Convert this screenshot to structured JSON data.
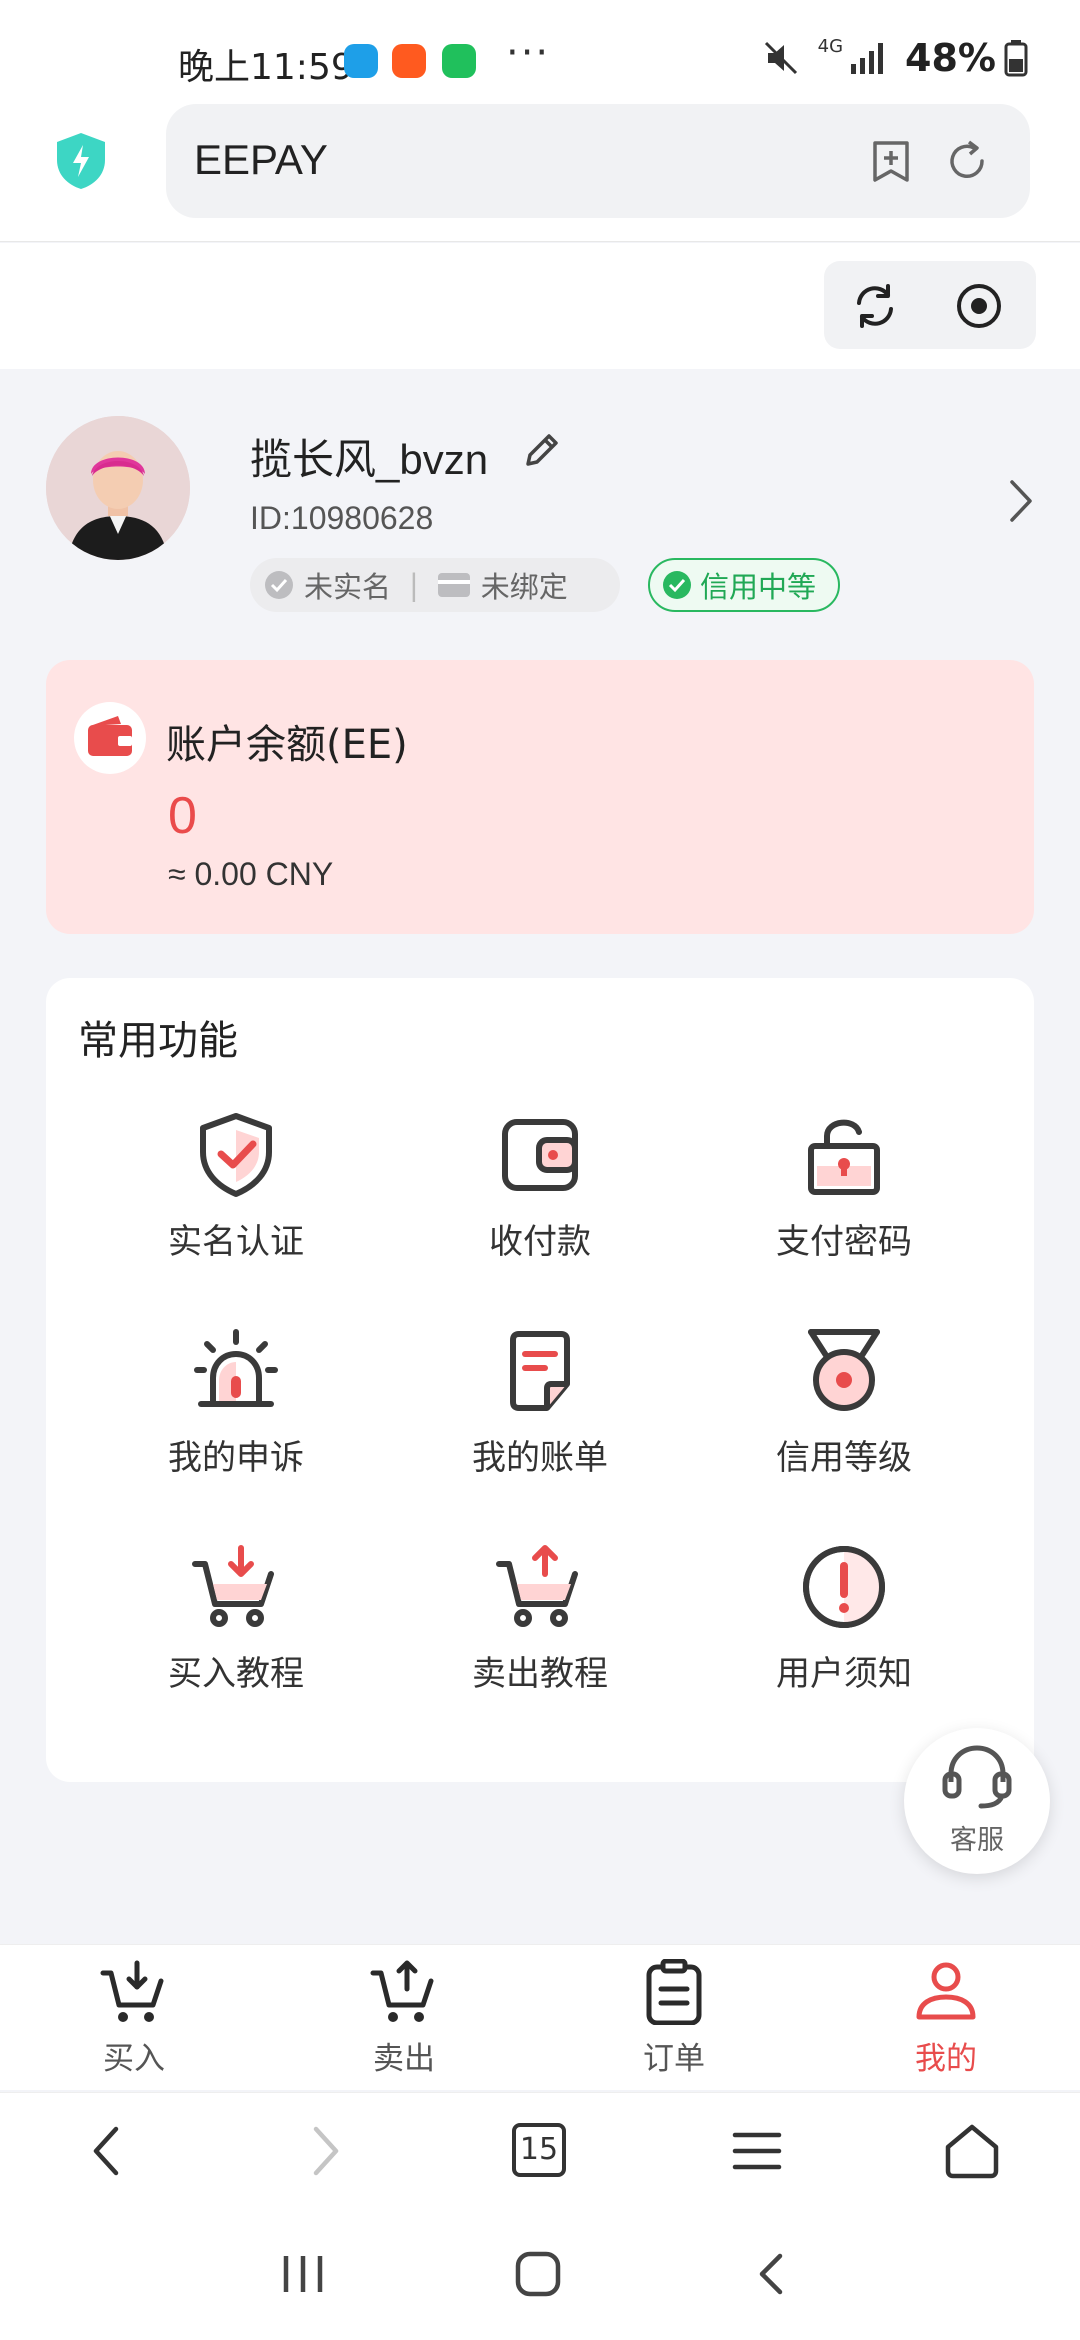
{
  "status_bar": {
    "time": "晚上11:59",
    "dots": "···",
    "network": "4G",
    "battery": "48%"
  },
  "browser": {
    "url_title": "EEPAY",
    "tab_count": "15"
  },
  "profile": {
    "username": "揽长风_bvzn",
    "id": "ID:10980628",
    "realname_status": "未实名",
    "bind_status": "未绑定",
    "separator": "|",
    "credit": "信用中等"
  },
  "balance": {
    "title": "账户余额(EE)",
    "value": "0",
    "cny": "≈ 0.00 CNY"
  },
  "functions": {
    "title": "常用功能",
    "items": [
      {
        "label": "实名认证",
        "icon": "shield-check-icon"
      },
      {
        "label": "收付款",
        "icon": "wallet-icon"
      },
      {
        "label": "支付密码",
        "icon": "unlock-icon"
      },
      {
        "label": "我的申诉",
        "icon": "alarm-icon"
      },
      {
        "label": "我的账单",
        "icon": "bill-icon"
      },
      {
        "label": "信用等级",
        "icon": "medal-icon"
      },
      {
        "label": "买入教程",
        "icon": "cart-in-icon"
      },
      {
        "label": "卖出教程",
        "icon": "cart-out-icon"
      },
      {
        "label": "用户须知",
        "icon": "notice-icon"
      }
    ]
  },
  "service": {
    "label": "客服"
  },
  "tabs": [
    {
      "label": "买入",
      "active": false
    },
    {
      "label": "卖出",
      "active": false
    },
    {
      "label": "订单",
      "active": false
    },
    {
      "label": "我的",
      "active": true
    }
  ],
  "colors": {
    "accent": "#e84c4c",
    "balance_bg": "#ffe4e4",
    "credit_green": "#20a855",
    "shield_teal": "#3dd6c4"
  }
}
